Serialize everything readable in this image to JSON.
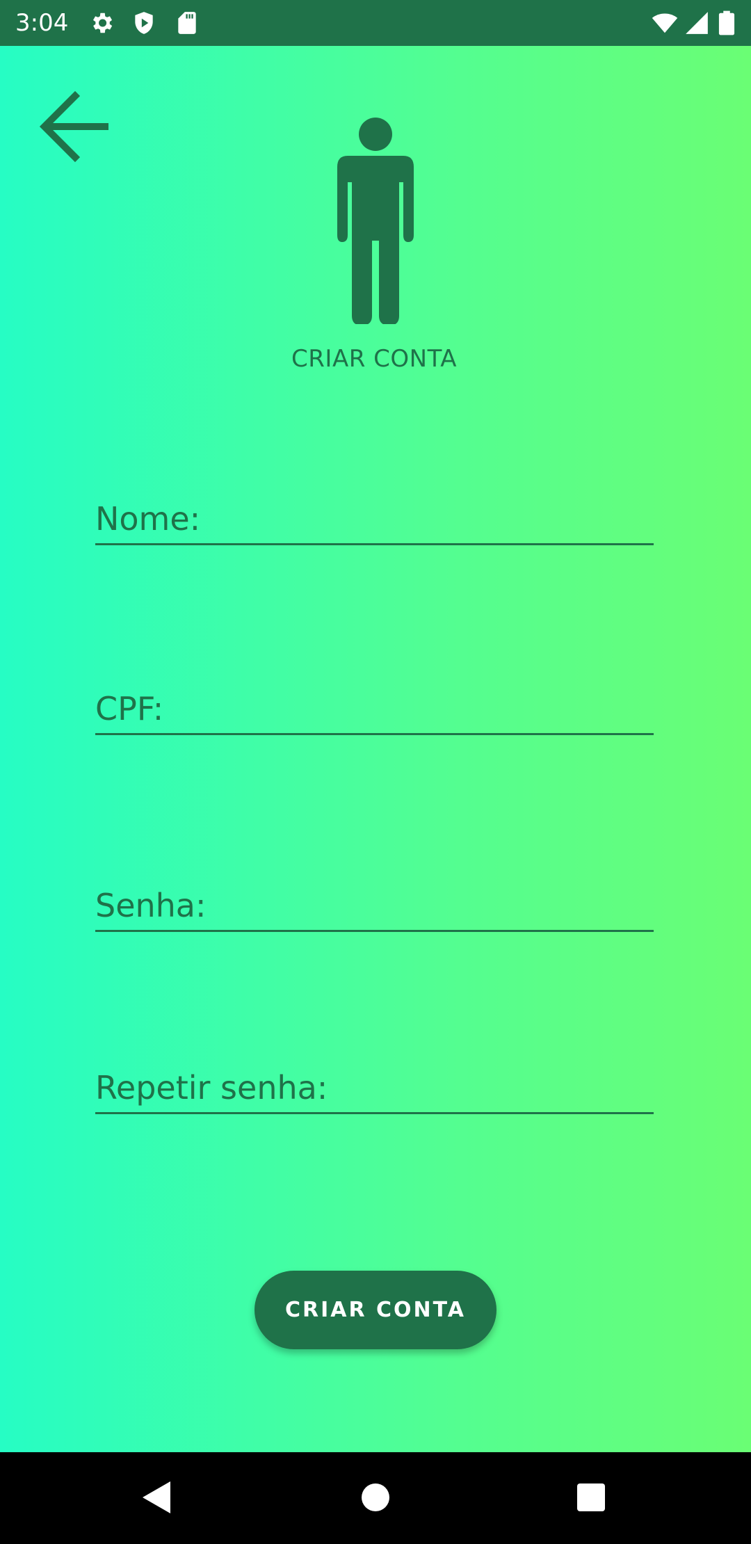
{
  "status_bar": {
    "time": "3:04",
    "left_icons": [
      "gear-icon",
      "shield-play-icon",
      "sd-card-icon"
    ],
    "right_icons": [
      "wifi-icon",
      "signal-icon",
      "battery-icon"
    ]
  },
  "header": {
    "back_icon": "arrow-left-icon",
    "avatar_icon": "person-icon",
    "title": "CRIAR CONTA"
  },
  "form": {
    "fields": [
      {
        "name": "nome",
        "label": "Nome:",
        "value": ""
      },
      {
        "name": "cpf",
        "label": "CPF:",
        "value": ""
      },
      {
        "name": "senha",
        "label": "Senha:",
        "value": ""
      },
      {
        "name": "repetir-senha",
        "label": "Repetir senha:",
        "value": ""
      }
    ],
    "submit_label": "CRIAR CONTA"
  },
  "nav_bar": {
    "icons": [
      "back-triangle-icon",
      "home-circle-icon",
      "recents-square-icon"
    ]
  },
  "colors": {
    "primary": "#1f7249",
    "gradient_start": "#26fdc4",
    "gradient_end": "#6afe74",
    "status_bar": "#1f7249",
    "nav_bar": "#000000"
  }
}
